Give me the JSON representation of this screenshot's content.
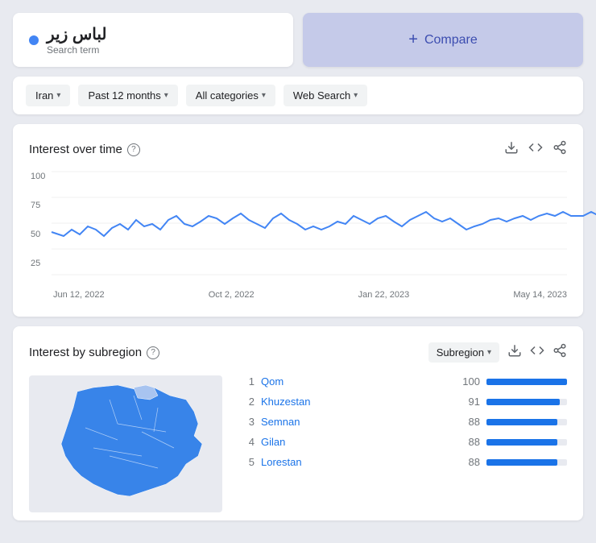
{
  "searchTerm": {
    "text": "لباس زیر",
    "label": "Search term"
  },
  "compare": {
    "plus": "+",
    "label": "Compare"
  },
  "filters": [
    {
      "id": "region",
      "label": "Iran"
    },
    {
      "id": "time",
      "label": "Past 12 months"
    },
    {
      "id": "category",
      "label": "All categories"
    },
    {
      "id": "type",
      "label": "Web Search"
    }
  ],
  "interestOverTime": {
    "title": "Interest over time",
    "yLabels": [
      "100",
      "75",
      "50",
      "25"
    ],
    "xLabels": [
      "Jun 12, 2022",
      "Oct 2, 2022",
      "Jan 22, 2023",
      "May 14, 2023"
    ],
    "actions": [
      "download",
      "embed",
      "share"
    ]
  },
  "interestBySubregion": {
    "title": "Interest by subregion",
    "dropdownLabel": "Subregion",
    "rankings": [
      {
        "rank": 1,
        "name": "Qom",
        "score": 100,
        "barPct": 100
      },
      {
        "rank": 2,
        "name": "Khuzestan",
        "score": 91,
        "barPct": 91
      },
      {
        "rank": 3,
        "name": "Semnan",
        "score": 88,
        "barPct": 88
      },
      {
        "rank": 4,
        "name": "Gilan",
        "score": 88,
        "barPct": 88
      },
      {
        "rank": 5,
        "name": "Lorestan",
        "score": 88,
        "barPct": 88
      }
    ]
  }
}
